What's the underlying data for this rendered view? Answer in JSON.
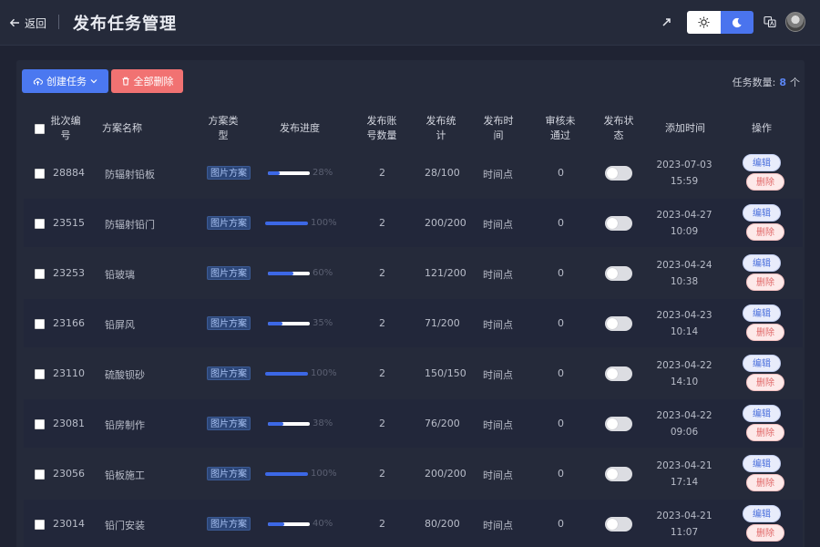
{
  "header": {
    "back_label": "返回",
    "title": "发布任务管理",
    "icons": [
      "arrow-left-icon",
      "pointer-icon",
      "sun-icon",
      "moon-icon",
      "translate-icon"
    ]
  },
  "toolbar": {
    "create_label": "创建任务",
    "delete_all_label": "全部删除",
    "count_label": "任务数量:",
    "count_value": "8",
    "count_unit": "个"
  },
  "colors": {
    "background": "#1f2333",
    "panel": "#252a3a",
    "primary": "#4b78f0",
    "danger": "#f17272",
    "progress": "#3c68e6"
  },
  "table": {
    "columns": {
      "batch_no_1": "批次编",
      "batch_no_2": "号",
      "plan_name": "方案名称",
      "plan_type_1": "方案类",
      "plan_type_2": "型",
      "progress": "发布进度",
      "accounts_1": "发布账",
      "accounts_2": "号数量",
      "stats_1": "发布统",
      "stats_2": "计",
      "time_1": "发布时",
      "time_2": "间",
      "rejected_1": "审核未",
      "rejected_2": "通过",
      "status_1": "发布状",
      "status_2": "态",
      "added": "添加时间",
      "actions": "操作"
    },
    "rows": [
      {
        "id": "28884",
        "name": "防辐射铅板",
        "type": "图片方案",
        "progress": 28,
        "progress_label": "28%",
        "accounts": "2",
        "stats": "28/100",
        "time": "时间点",
        "rejected": "0",
        "status_on": false,
        "date": "2023-07-03",
        "clock": "15:59",
        "edit": "编辑",
        "delete": "删除"
      },
      {
        "id": "23515",
        "name": "防辐射铅门",
        "type": "图片方案",
        "progress": 100,
        "progress_label": "100%",
        "accounts": "2",
        "stats": "200/200",
        "time": "时间点",
        "rejected": "0",
        "status_on": false,
        "date": "2023-04-27",
        "clock": "10:09",
        "edit": "编辑",
        "delete": "删除"
      },
      {
        "id": "23253",
        "name": "铅玻璃",
        "type": "图片方案",
        "progress": 60,
        "progress_label": "60%",
        "accounts": "2",
        "stats": "121/200",
        "time": "时间点",
        "rejected": "0",
        "status_on": false,
        "date": "2023-04-24",
        "clock": "10:38",
        "edit": "编辑",
        "delete": "删除"
      },
      {
        "id": "23166",
        "name": "铅屏风",
        "type": "图片方案",
        "progress": 35,
        "progress_label": "35%",
        "accounts": "2",
        "stats": "71/200",
        "time": "时间点",
        "rejected": "0",
        "status_on": false,
        "date": "2023-04-23",
        "clock": "10:14",
        "edit": "编辑",
        "delete": "删除"
      },
      {
        "id": "23110",
        "name": "硫酸钡砂",
        "type": "图片方案",
        "progress": 100,
        "progress_label": "100%",
        "accounts": "2",
        "stats": "150/150",
        "time": "时间点",
        "rejected": "0",
        "status_on": false,
        "date": "2023-04-22",
        "clock": "14:10",
        "edit": "编辑",
        "delete": "删除"
      },
      {
        "id": "23081",
        "name": "铅房制作",
        "type": "图片方案",
        "progress": 38,
        "progress_label": "38%",
        "accounts": "2",
        "stats": "76/200",
        "time": "时间点",
        "rejected": "0",
        "status_on": false,
        "date": "2023-04-22",
        "clock": "09:06",
        "edit": "编辑",
        "delete": "删除"
      },
      {
        "id": "23056",
        "name": "铅板施工",
        "type": "图片方案",
        "progress": 100,
        "progress_label": "100%",
        "accounts": "2",
        "stats": "200/200",
        "time": "时间点",
        "rejected": "0",
        "status_on": false,
        "date": "2023-04-21",
        "clock": "17:14",
        "edit": "编辑",
        "delete": "删除"
      },
      {
        "id": "23014",
        "name": "铅门安装",
        "type": "图片方案",
        "progress": 40,
        "progress_label": "40%",
        "accounts": "2",
        "stats": "80/200",
        "time": "时间点",
        "rejected": "0",
        "status_on": false,
        "date": "2023-04-21",
        "clock": "11:07",
        "edit": "编辑",
        "delete": "删除"
      }
    ]
  }
}
